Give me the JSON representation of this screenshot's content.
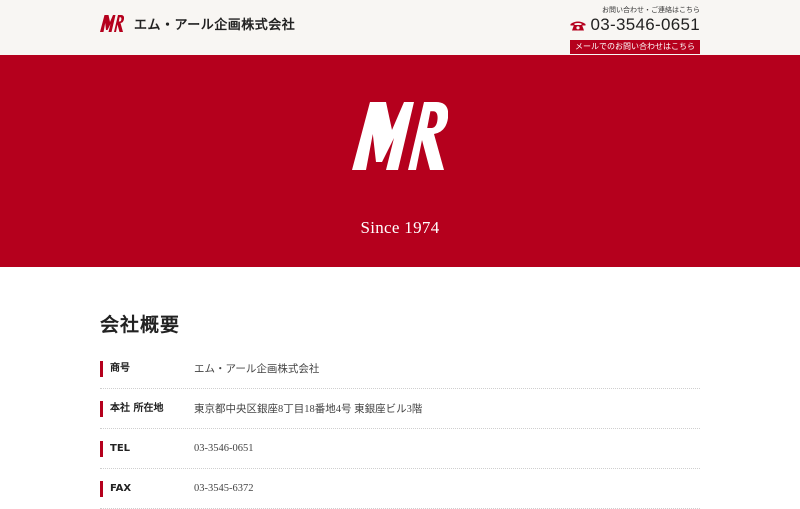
{
  "header": {
    "logo_text": "MR",
    "company_name": "エム・アール企画株式会社",
    "contact_caption": "お問い合わせ・ご連絡はこちら",
    "phone_icon": "phone-icon",
    "phone_number": "03-3546-0651",
    "mail_button_label": "メールでのお問い合わせはこちら"
  },
  "hero": {
    "logo_text": "MR",
    "since": "Since 1974"
  },
  "main": {
    "title": "会社概要",
    "rows": [
      {
        "label": "商号",
        "value": "エム・アール企画株式会社"
      },
      {
        "label": "本社 所在地",
        "value": "東京都中央区銀座8丁目18番地4号 東銀座ビル3階"
      },
      {
        "label": "TEL",
        "value": "03-3546-0651"
      },
      {
        "label": "FAX",
        "value": "03-3545-6372"
      }
    ]
  },
  "colors": {
    "brand_red": "#b5001d",
    "header_bg": "#f8f6f3"
  }
}
